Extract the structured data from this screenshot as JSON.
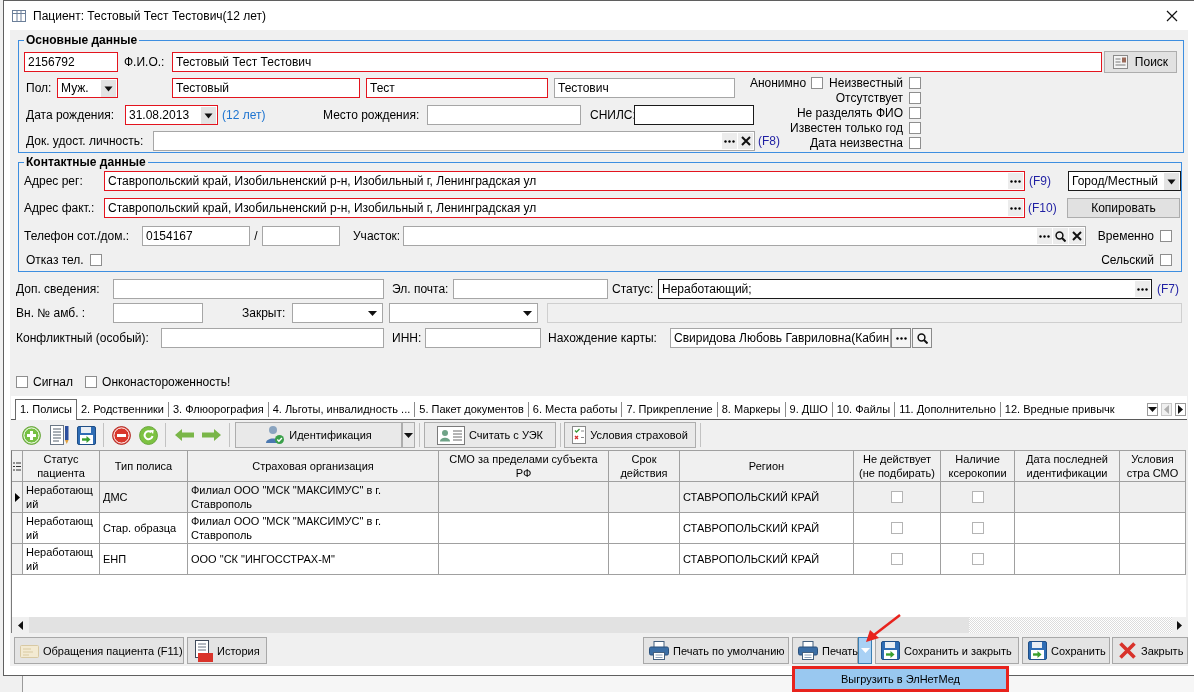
{
  "window": {
    "title": "Пациент: Тестовый Тест Тестович(12 лет)"
  },
  "main": {
    "title": "Основные данные",
    "card_number": {
      "value": "2156792",
      "required": true
    },
    "fio_label": "Ф.И.О.:",
    "fio": {
      "value": "Тестовый Тест Тестович",
      "required": true
    },
    "search_button": "Поиск",
    "sex_label": "Пол:",
    "sex": {
      "value": "Муж.",
      "required": true
    },
    "last_name": {
      "value": "Тестовый",
      "required": true
    },
    "first_name": {
      "value": "Тест",
      "required": true
    },
    "middle_name": {
      "value": "Тестович",
      "required": false
    },
    "birth_date_label": "Дата рождения:",
    "birth_date": {
      "value": "31.08.2013",
      "required": true
    },
    "age": "(12 лет)",
    "birthplace_label": "Место рождения:",
    "snils_label": "СНИЛС:",
    "id_document_label": "Док. удост. личность:",
    "id_document_hotkey": "(F8)",
    "anonymous": {
      "label": "Анонимно",
      "checked": false
    },
    "flags": [
      {
        "label": "Неизвестный",
        "checked": false
      },
      {
        "label": "Отсутствует",
        "checked": false
      },
      {
        "label": "Не разделять ФИО",
        "checked": false
      },
      {
        "label": "Известен только год",
        "checked": false
      },
      {
        "label": "Дата неизвестна",
        "checked": false
      }
    ]
  },
  "contacts": {
    "title": "Контактные данные",
    "reg_address_label": "Адрес рег:",
    "reg_address": {
      "value": "Ставропольский край, Изобильненский р-н, Изобильный г, Ленинградская ул",
      "required": true
    },
    "reg_address_hotkey": "(F9)",
    "locality": "Город/Местный",
    "fact_address_label": "Адрес факт.:",
    "fact_address": {
      "value": "Ставропольский край, Изобильненский р-н, Изобильный г, Ленинградская ул",
      "required": true
    },
    "fact_address_hotkey": "(F10)",
    "copy_button": "Копировать",
    "phone_label": "Телефон сот./дом.:",
    "mobile_phone": "0154167",
    "phone_separator": "/",
    "district_label": "Участок:",
    "temporary": {
      "label": "Временно",
      "checked": false
    },
    "phone_refused": {
      "label": "Отказ тел.",
      "checked": false
    },
    "rural": {
      "label": "Сельский",
      "checked": false
    }
  },
  "details": {
    "extra_info_label": "Доп. сведения:",
    "email_label": "Эл. почта:",
    "status_label": "Статус:",
    "status": "Неработающий;",
    "status_hotkey": "(F7)",
    "outpatient_number_label": "Вн. № амб. :",
    "closed_label": "Закрыт:",
    "conflict_label": "Конфликтный (особый):",
    "inn_label": "ИНН:",
    "card_location_label": "Нахождение карты:",
    "card_location": "Свиридова Любовь Гавриловна(Кабин",
    "flags": [
      {
        "label": "Сигнал",
        "checked": false
      },
      {
        "label": "Онконастороженность!",
        "checked": false
      }
    ]
  },
  "tabs": [
    {
      "label": "1. Полисы",
      "selected": true
    },
    {
      "label": "2. Родственники",
      "selected": false
    },
    {
      "label": "3. Флюорография",
      "selected": false
    },
    {
      "label": "4. Льготы, инвалидность ...",
      "selected": false
    },
    {
      "label": "5. Пакет документов",
      "selected": false
    },
    {
      "label": "6. Места работы",
      "selected": false
    },
    {
      "label": "7. Прикрепление",
      "selected": false
    },
    {
      "label": "8. Маркеры",
      "selected": false
    },
    {
      "label": "9. ДШО",
      "selected": false
    },
    {
      "label": "10. Файлы",
      "selected": false
    },
    {
      "label": "11. Дополнительно",
      "selected": false
    },
    {
      "label": "12. Вредные привычк",
      "selected": false
    }
  ],
  "toolbar": {
    "buttons": [
      {
        "label": "Идентификация",
        "kind": "split"
      },
      {
        "label": "Считать с УЭК",
        "kind": "plain"
      },
      {
        "label": "Условия страховой",
        "kind": "plain"
      }
    ]
  },
  "table": {
    "columns": [
      "Статус пациента",
      "Тип полиса",
      "Страховая организация",
      "СМО за пределами субъекта РФ",
      "Срок действия",
      "Регион",
      "Не действует (не подбирать)",
      "Наличие ксерокопии",
      "Дата последней идентификации",
      "Условия стра СМО"
    ],
    "rows": [
      {
        "selected": true,
        "status": "Неработающий",
        "policy_type": "ДМС",
        "insurer": "Филиал ООО \"МСК \"МАКСИМУС\" в г. Ставрополь",
        "region": "СТАВРОПОЛЬСКИЙ КРАЙ",
        "not_active": false,
        "has_copy": false
      },
      {
        "selected": false,
        "status": "Неработающий",
        "policy_type": "Стар. образца",
        "insurer": "Филиал ООО \"МСК \"МАКСИМУС\" в г. Ставрополь",
        "region": "СТАВРОПОЛЬСКИЙ КРАЙ",
        "not_active": false,
        "has_copy": false
      },
      {
        "selected": false,
        "status": "Неработающий",
        "policy_type": "ЕНП",
        "insurer": "ООО \"СК \"ИНГОССТРАХ-М\"",
        "region": "СТАВРОПОЛЬСКИЙ КРАЙ",
        "not_active": false,
        "has_copy": false
      }
    ]
  },
  "footer": {
    "left_buttons": [
      "Обращения пациента (F11)",
      "История"
    ],
    "right_buttons": [
      {
        "label": "Печать по умолчанию",
        "kind": "plain"
      },
      {
        "label": "Печать",
        "kind": "split"
      },
      {
        "label": "Сохранить и закрыть",
        "kind": "plain"
      },
      {
        "label": "Сохранить",
        "kind": "plain"
      },
      {
        "label": "Закрыть",
        "kind": "plain"
      }
    ],
    "print_menu": {
      "open": true,
      "items": [
        {
          "label": "Выгрузить в ЭлНетМед",
          "highlighted": true
        }
      ]
    }
  }
}
